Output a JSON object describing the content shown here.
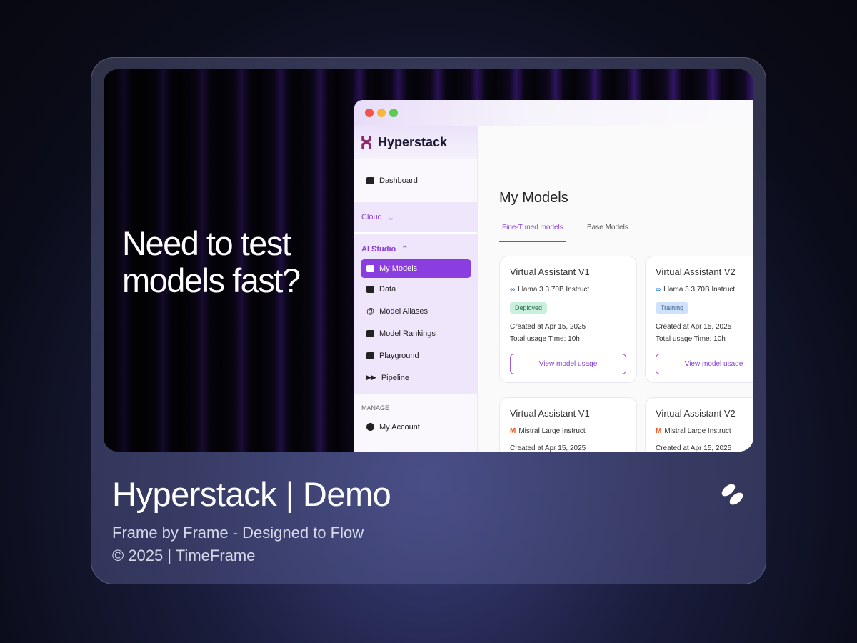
{
  "hero": {
    "headline_line1": "Need to test",
    "headline_line2": "models fast?"
  },
  "app": {
    "brand": "Hyperstack",
    "sidebar": {
      "dashboard": "Dashboard",
      "cloud": "Cloud",
      "ai_studio": "AI Studio",
      "items": [
        "My Models",
        "Data",
        "Model Aliases",
        "Model Rankings",
        "Playground",
        "Pipeline"
      ],
      "manage": "MANAGE",
      "my_account": "My Account"
    },
    "page_title": "My Models",
    "tabs": [
      "Fine-Tuned models",
      "Base Models"
    ],
    "cards": [
      {
        "name": "Virtual Assistant V1",
        "model": "Llama 3.3 70B Instruct",
        "status": "Deployed",
        "created": "Created at Apr 15, 2025",
        "usage": "Total usage Time: 10h",
        "button": "View model usage"
      },
      {
        "name": "Virtual Assistant V2",
        "model": "Llama 3.3 70B Instruct",
        "status": "Training",
        "created": "Created at Apr 15, 2025",
        "usage": "Total usage Time: 10h",
        "button": "View model usage"
      },
      {
        "name": "Virtual Assistant V1",
        "model": "Mistral Large Instruct",
        "created": "Created at Apr 15, 2025"
      },
      {
        "name": "Virtual Assistant V2",
        "model": "Mistral Large Instruct",
        "created": "Created at Apr 15, 2025"
      }
    ]
  },
  "footer": {
    "title": "Hyperstack | Demo",
    "tagline": "Frame by Frame - Designed to Flow",
    "copyright": "© 2025 | TimeFrame"
  },
  "colors": {
    "accent": "#8b3ee0",
    "deployed": "#c9f0dc",
    "training": "#cfe2fb"
  }
}
